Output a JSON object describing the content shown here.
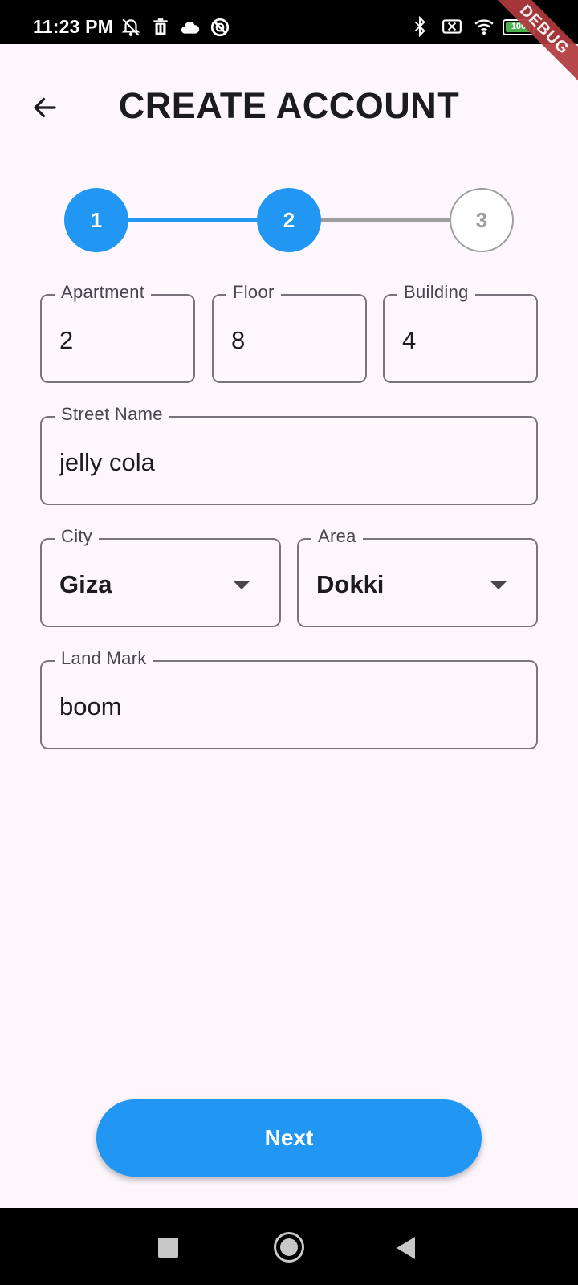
{
  "status_bar": {
    "time": "11:23 PM",
    "battery": "100",
    "icons_left": [
      "alarm-off-icon",
      "trash-icon",
      "cloud-icon",
      "blocked-icon"
    ],
    "icons_right": [
      "bluetooth-icon",
      "no-sim-icon",
      "wifi-icon",
      "battery-icon"
    ]
  },
  "debug_banner": "DEBUG",
  "header": {
    "title": "CREATE ACCOUNT",
    "back_icon": "arrow-left-icon"
  },
  "stepper": {
    "steps": [
      {
        "label": "1",
        "state": "completed"
      },
      {
        "label": "2",
        "state": "active"
      },
      {
        "label": "3",
        "state": "inactive"
      }
    ],
    "active_color": "#2196f3",
    "inactive_color": "#9e9e9e"
  },
  "form": {
    "apartment": {
      "label": "Apartment",
      "value": "2"
    },
    "floor": {
      "label": "Floor",
      "value": "8"
    },
    "building": {
      "label": "Building",
      "value": "4"
    },
    "street_name": {
      "label": "Street Name",
      "value": "jelly cola"
    },
    "city": {
      "label": "City",
      "value": "Giza"
    },
    "area": {
      "label": "Area",
      "value": "Dokki"
    },
    "land_mark": {
      "label": "Land Mark",
      "value": "boom"
    }
  },
  "next_button": {
    "label": "Next",
    "color": "#2196f3"
  },
  "nav_bar": {
    "icons": [
      "recent-apps-icon",
      "home-icon",
      "back-icon"
    ]
  }
}
